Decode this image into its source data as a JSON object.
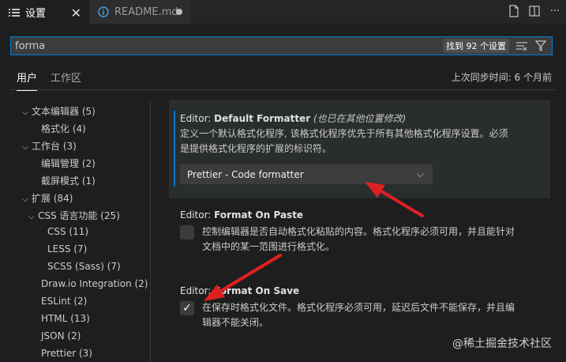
{
  "tabs": [
    {
      "label": "设置",
      "icon": "settings-list-icon",
      "active": true
    },
    {
      "label": "README.md",
      "icon": "info-icon",
      "active": false,
      "dirty": true
    }
  ],
  "search": {
    "value": "forma",
    "result_count": "找到 92 个设置"
  },
  "scope": {
    "user": "用户",
    "workspace": "工作区",
    "sync_status": "上次同步时间: 6 个月前"
  },
  "toc": [
    {
      "label": "文本编辑器 (5)",
      "expanded": true
    },
    {
      "label": "格式化 (4)"
    },
    {
      "label": "工作台 (3)",
      "expanded": true
    },
    {
      "label": "编辑管理 (2)"
    },
    {
      "label": "截屏模式 (1)"
    },
    {
      "label": "扩展 (84)",
      "expanded": true
    },
    {
      "label": "CSS 语言功能 (25)",
      "expanded": true
    },
    {
      "label": "CSS (11)"
    },
    {
      "label": "LESS (7)"
    },
    {
      "label": "SCSS (Sass) (7)"
    },
    {
      "label": "Draw.io Integration (2)"
    },
    {
      "label": "ESLint (2)"
    },
    {
      "label": "HTML (13)"
    },
    {
      "label": "JSON (2)"
    },
    {
      "label": "Prettier (3)"
    }
  ],
  "settings": {
    "default_formatter": {
      "category": "Editor: ",
      "name": "Default Formatter",
      "modified_note": "(也已在其他位置修改)",
      "desc_line1": "定义一个默认格式化程序, 该格式化程序优先于所有其他格式化程序设置。必须",
      "desc_line2": "是提供格式化程序的扩展的标识符。",
      "value": "Prettier - Code formatter"
    },
    "format_on_paste": {
      "category": "Editor: ",
      "name": "Format On Paste",
      "desc_line1": "控制编辑器是否自动格式化粘贴的内容。格式化程序必须可用，并且能针对",
      "desc_line2": "文档中的某一范围进行格式化。",
      "checked": false
    },
    "format_on_save": {
      "category": "Editor: ",
      "name": "Format On Save",
      "desc_line1": "在保存时格式化文件。格式化程序必须可用，延迟后文件不能保存，并且编",
      "desc_line2": "辑器不能关闭。",
      "checked": true
    }
  },
  "watermark": "@稀土掘金技术社区",
  "colors": {
    "accent": "#007acc",
    "arrow": "#e02020",
    "background": "#1e1e1e"
  }
}
